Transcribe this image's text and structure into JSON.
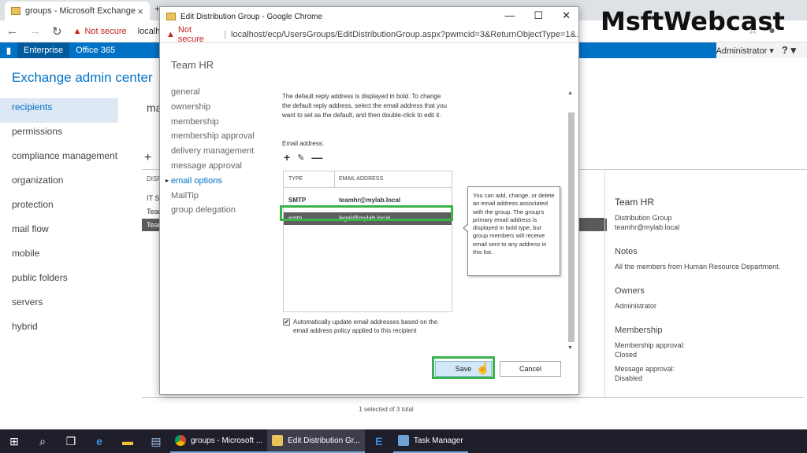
{
  "bg_browser": {
    "tab_title": "groups - Microsoft Exchange",
    "not_secure": "Not secure",
    "url_fragment": "localho"
  },
  "office_bar": {
    "enterprise": "Enterprise",
    "office365": "Office 365",
    "admin": "Administrator ▾",
    "help": "? ▾"
  },
  "eac": {
    "title": "Exchange admin center",
    "nav": [
      "recipients",
      "permissions",
      "compliance management",
      "organization",
      "protection",
      "mail flow",
      "mobile",
      "public folders",
      "servers",
      "hybrid"
    ],
    "main_frag": "ma",
    "list_header": "DISP",
    "list_rows": [
      "IT S",
      "Team",
      "Team"
    ],
    "footer": "1 selected of 3 total"
  },
  "details": {
    "title": "Team HR",
    "type": "Distribution Group",
    "email": "teamhr@mylab.local",
    "notes_label": "Notes",
    "notes": "All the members from Human Resource Department.",
    "owners_label": "Owners",
    "owners": "Administrator",
    "membership_label": "Membership",
    "approval_label": "Membership approval:",
    "approval_value": "Closed",
    "msg_approval_label": "Message approval:",
    "msg_approval_value": "Disabled"
  },
  "watermark": "MsftWebcast",
  "popup": {
    "window_title": "Edit Distribution Group - Google Chrome",
    "not_secure": "Not secure",
    "url": "localhost/ecp/UsersGroups/EditDistributionGroup.aspx?pwmcid=3&ReturnObjectType=1&...",
    "group_name": "Team HR",
    "nav": [
      "general",
      "ownership",
      "membership",
      "membership approval",
      "delivery management",
      "message approval",
      "email options",
      "MailTip",
      "group delegation"
    ],
    "description": "The default reply address is displayed in bold. To change the default reply address, select the email address that you want to set as the default, and then double-click to edit it.",
    "email_label": "Email address:",
    "table_headers": [
      "TYPE",
      "EMAIL ADDRESS"
    ],
    "rows": [
      {
        "type": "SMTP",
        "address": "teamhr@mylab.local"
      },
      {
        "type": "smtp",
        "address": "legal@mylab.local"
      }
    ],
    "tooltip": "You can add, change, or delete an email address associated with the group. The group's primary email address is displayed in bold type, but group members will receive email sent to any address in this list.",
    "auto_update": "Automatically update email addresses based on the email address policy applied to this recipient",
    "save": "Save",
    "cancel": "Cancel"
  },
  "taskbar": {
    "apps": [
      "groups - Microsoft ...",
      "Edit Distribution Gr...",
      "Task Manager"
    ]
  }
}
